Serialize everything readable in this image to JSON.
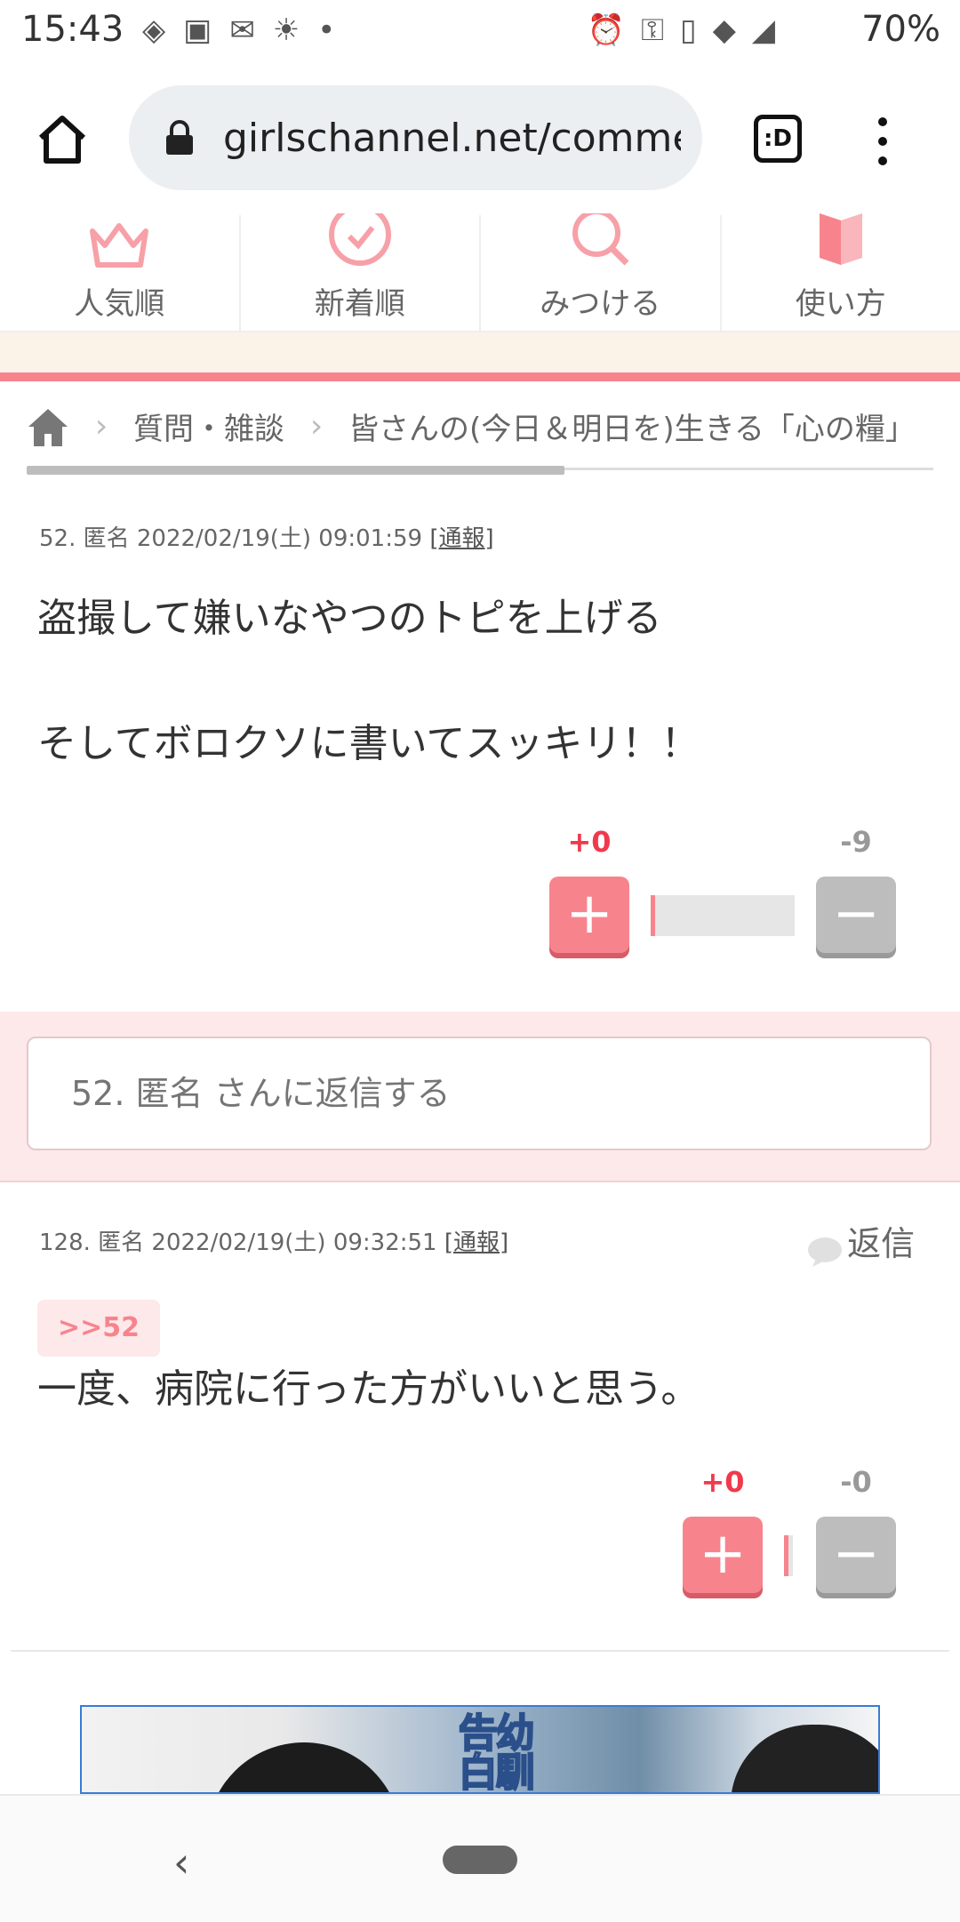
{
  "status": {
    "time": "15:43",
    "battery": "70%"
  },
  "browser": {
    "url": "girlschannel.net/comme",
    "tabs_label": ":D"
  },
  "nav": {
    "items": [
      {
        "label": "人気順",
        "icon": "crown-icon"
      },
      {
        "label": "新着順",
        "icon": "clock-icon"
      },
      {
        "label": "みつける",
        "icon": "magnifier-icon"
      },
      {
        "label": "使い方",
        "icon": "book-icon"
      }
    ]
  },
  "breadcrumb": {
    "level1": "質問・雑談",
    "level2": "皆さんの(今日＆明日を)生きる「心の糧」"
  },
  "comment1": {
    "meta": "52. 匿名 2022/02/19(土) 09:01:59",
    "report": "[通報]",
    "line1": "盗撮して嫌いなやつのトピを上げる",
    "line2": "そしてボロクソに書いてスッキリ！！",
    "plus": "+0",
    "minus": "-9",
    "plus_icon": "+",
    "minus_icon": "−"
  },
  "reply_box": {
    "placeholder": "52. 匿名 さんに返信する"
  },
  "comment2": {
    "meta": "128. 匿名 2022/02/19(土) 09:32:51",
    "report": "[通報]",
    "reply_label": "返信",
    "anchor": ">>52",
    "text": "一度、病院に行った方がいいと思う。",
    "plus": "+0",
    "minus": "-0",
    "plus_icon": "+",
    "minus_icon": "−"
  },
  "ad": {
    "caption_a": "幼馴",
    "caption_b": "告白"
  },
  "sysnav": {
    "back": "‹"
  },
  "colors": {
    "accent": "#f7848d",
    "plus_text": "#f0394c",
    "reply_bg": "#fde8ea"
  }
}
